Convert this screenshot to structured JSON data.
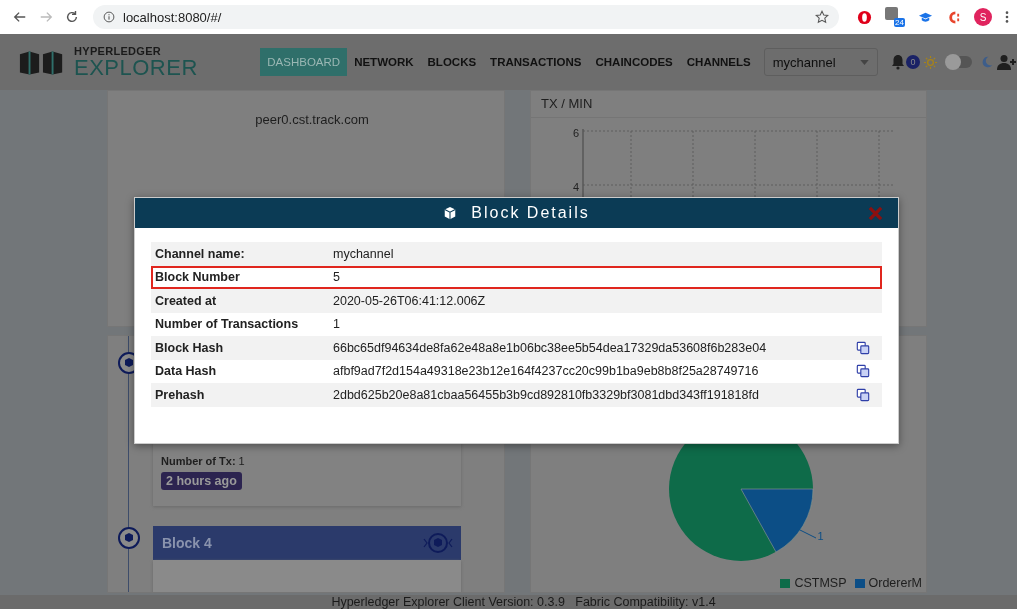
{
  "browser": {
    "url": "localhost:8080/#/",
    "profile_initial": "S",
    "extension_badge": "24"
  },
  "header": {
    "logo_top": "HYPERLEDGER",
    "logo_bottom": "EXPLORER",
    "nav": [
      {
        "label": "DASHBOARD",
        "selected": true
      },
      {
        "label": "NETWORK",
        "selected": false
      },
      {
        "label": "BLOCKS",
        "selected": false
      },
      {
        "label": "TRANSACTIONS",
        "selected": false
      },
      {
        "label": "CHAINCODES",
        "selected": false
      },
      {
        "label": "CHANNELS",
        "selected": false
      }
    ],
    "channel_select": {
      "value": "mychannel"
    },
    "notification_count": "0",
    "dark_mode": {
      "on": false
    }
  },
  "peer_panel": {
    "peer": "peer0.cst.track.com"
  },
  "tx_chart": {
    "title": "TX / MIN",
    "y_ticks": [
      "6",
      "4"
    ]
  },
  "timeline": {
    "tx_label": "Number of Tx:",
    "tx_value": "1",
    "age": "2 hours ago",
    "next_block": "Block 4"
  },
  "org_chart": {
    "slice_label": "1",
    "legend": [
      {
        "name": "CSTMSP",
        "color": "#0e6b49"
      },
      {
        "name": "OrdererM",
        "color": "#0c4e86"
      }
    ]
  },
  "footer": "Hyperledger Explorer Client Version: 0.3.9   Fabric Compatibility: v1.4",
  "modal": {
    "title": "Block Details",
    "rows": [
      {
        "label": "Channel name:",
        "value": "mychannel",
        "highlighted": false,
        "copyable": false
      },
      {
        "label": "Block Number",
        "value": "5",
        "highlighted": true,
        "copyable": false
      },
      {
        "label": "Created at",
        "value": "2020-05-26T06:41:12.006Z",
        "highlighted": false,
        "copyable": false
      },
      {
        "label": "Number of Transactions",
        "value": "1",
        "highlighted": false,
        "copyable": false
      },
      {
        "label": "Block Hash",
        "value": "66bc65df94634de8fa62e48a8e1b06bc38ee5b54dea17329da53608f6b283e04",
        "highlighted": false,
        "copyable": true
      },
      {
        "label": "Data Hash",
        "value": "afbf9ad7f2d154a49318e23b12e164f4237cc20c99b1ba9eb8b8f25a28749716",
        "highlighted": false,
        "copyable": true
      },
      {
        "label": "Prehash",
        "value": "2dbd625b20e8a81cbaa56455b3b9cd892810fb3329bf3081dbd343ff191818fd",
        "highlighted": false,
        "copyable": true
      }
    ]
  }
}
